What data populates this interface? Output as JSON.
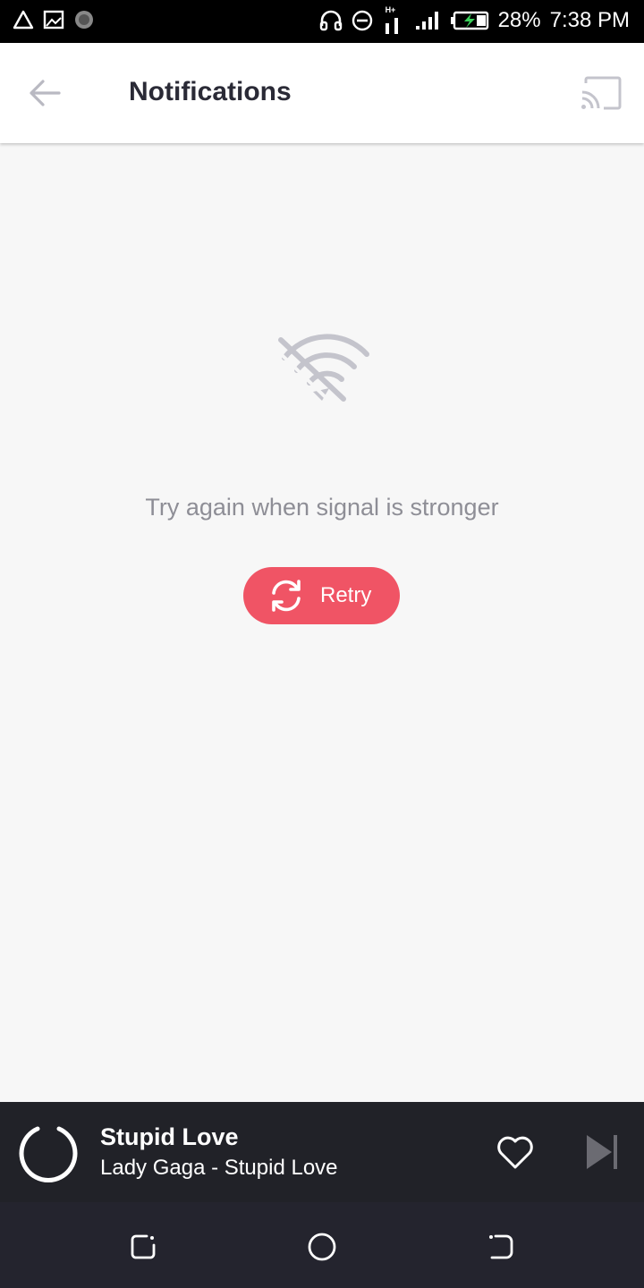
{
  "status_bar": {
    "battery_percent": "28%",
    "time": "7:38 PM",
    "network_type": "H+",
    "icons": [
      "warning-icon",
      "picture-icon",
      "spinner-icon",
      "headphones-icon",
      "do-not-disturb-icon",
      "mobile-data-icon",
      "signal-icon",
      "battery-charging-icon"
    ]
  },
  "app_bar": {
    "title": "Notifications",
    "back_icon": "arrow-back-icon",
    "cast_icon": "cast-icon"
  },
  "empty_state": {
    "icon": "wifi-off-icon",
    "message": "Try again when signal is stronger",
    "retry_label": "Retry",
    "retry_icon": "refresh-icon"
  },
  "mini_player": {
    "title": "Stupid Love",
    "subtitle": "Lady Gaga - Stupid Love",
    "like_icon": "heart-outline-icon",
    "next_icon": "skip-next-icon"
  },
  "nav_bar": {
    "icons": [
      "recents-icon",
      "home-icon",
      "back-icon"
    ]
  },
  "colors": {
    "accent": "#f05465",
    "player_bg": "#212228",
    "nav_bg": "#24242e",
    "icon_gray": "#c4c4cc",
    "text_gray": "#8e8e96"
  }
}
